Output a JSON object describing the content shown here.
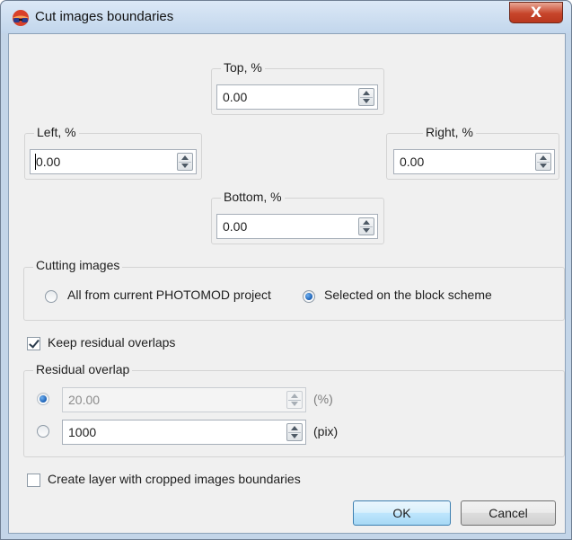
{
  "window": {
    "title": "Cut images boundaries",
    "close_label": "X"
  },
  "margins": {
    "top": {
      "label": "Top, %",
      "value": "0.00"
    },
    "left": {
      "label": "Left, %",
      "value": "0.00"
    },
    "right": {
      "label": "Right, %",
      "value": "0.00"
    },
    "bottom": {
      "label": "Bottom, %",
      "value": "0.00"
    }
  },
  "cutting_images": {
    "label": "Cutting images",
    "options": [
      {
        "label": "All from current PHOTOMOD project",
        "selected": false
      },
      {
        "label": "Selected on the block scheme",
        "selected": true
      }
    ]
  },
  "keep_residual": {
    "label": "Keep residual overlaps",
    "checked": true
  },
  "residual_overlap": {
    "label": "Residual overlap",
    "percent": {
      "value": "20.00",
      "unit": "(%)",
      "selected": true,
      "enabled": false
    },
    "pixels": {
      "value": "1000",
      "unit": "(pix)",
      "selected": false,
      "enabled": true
    }
  },
  "create_layer": {
    "label": "Create layer with cropped images boundaries",
    "checked": false
  },
  "buttons": {
    "ok": "OK",
    "cancel": "Cancel"
  },
  "colors": {
    "title_bar": "#c2d6ec",
    "dialog_bg": "#f0f0f0",
    "close_button": "#c7452b",
    "default_button": "#bee6fd"
  }
}
